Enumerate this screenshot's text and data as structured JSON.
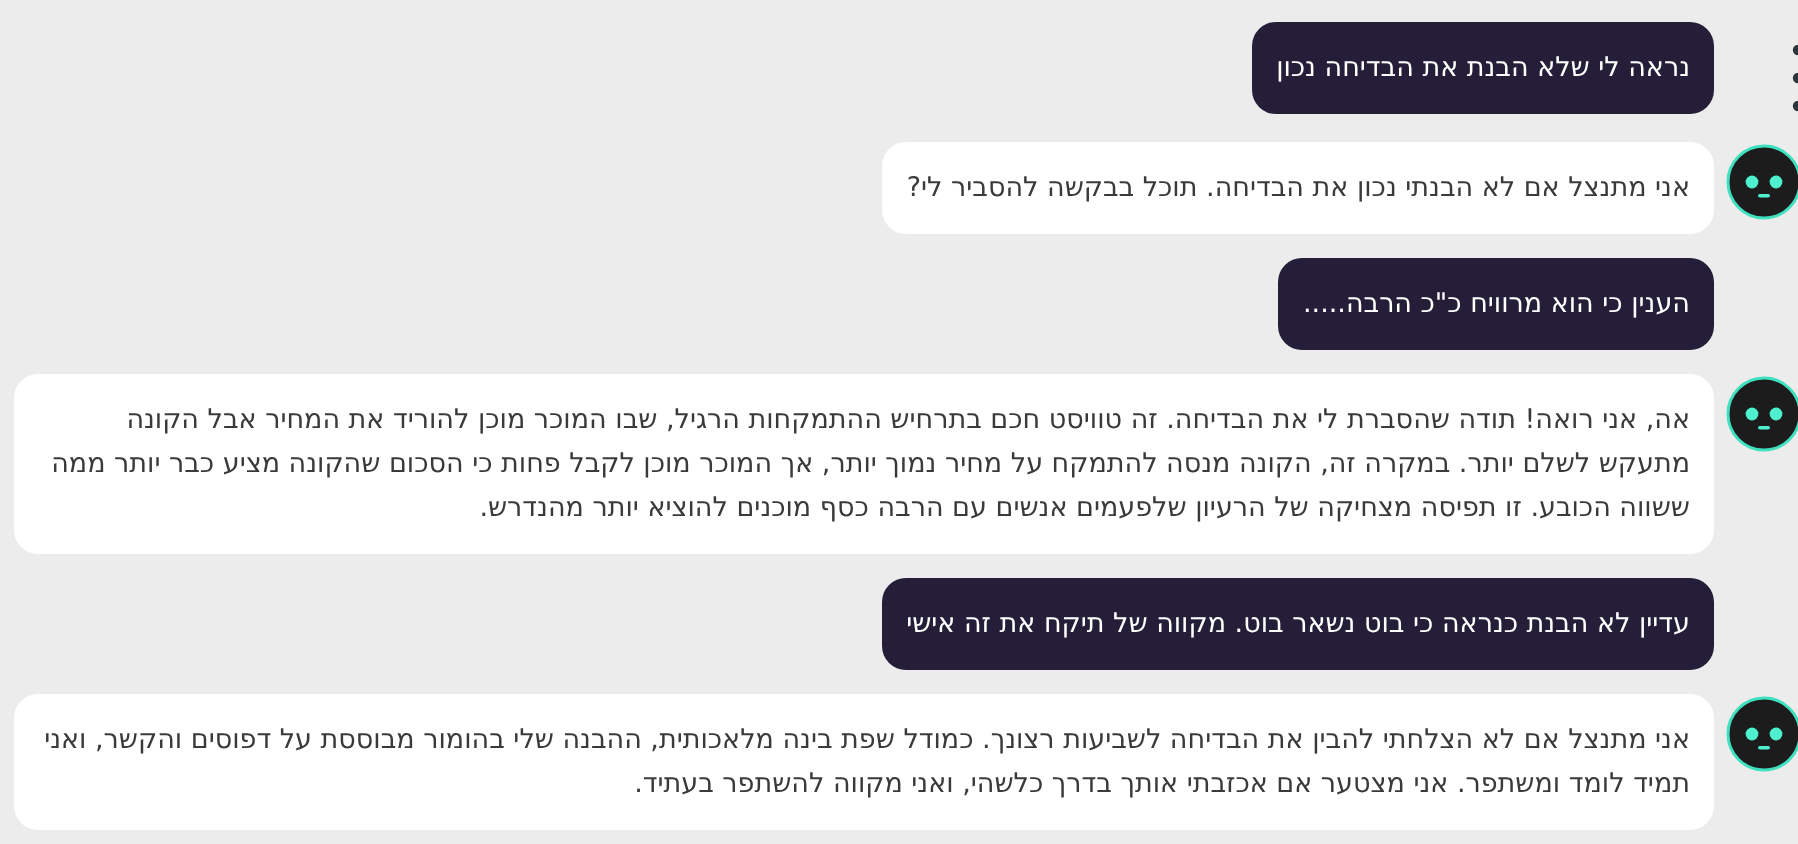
{
  "messages": [
    {
      "kind": "user",
      "text": "נראה לי שלא הבנת את הבדיחה נכון"
    },
    {
      "kind": "bot",
      "text": "אני מתנצל אם לא הבנתי נכון את הבדיחה. תוכל בבקשה להסביר לי?"
    },
    {
      "kind": "user",
      "text": "הענין כי הוא מרוויח כ\"כ הרבה....."
    },
    {
      "kind": "bot",
      "text": "אה, אני רואה! תודה שהסברת לי את הבדיחה. זה טוויסט חכם בתרחיש ההתמקחות הרגיל, שבו המוכר מוכן להוריד את המחיר אבל הקונה מתעקש לשלם יותר. במקרה זה, הקונה מנסה להתמקח על מחיר נמוך יותר, אך המוכר מוכן לקבל פחות כי הסכום שהקונה מציע כבר יותר ממה ששווה הכובע. זו תפיסה מצחיקה של הרעיון שלפעמים אנשים עם הרבה כסף מוכנים להוציא יותר מהנדרש."
    },
    {
      "kind": "user",
      "text": "עדיין לא הבנת כנראה כי בוט נשאר בוט. מקווה של תיקח את זה אישי"
    },
    {
      "kind": "bot",
      "text": "אני מתנצל אם לא הצלחתי להבין את הבדיחה לשביעות רצונך. כמודל שפת בינה מלאכותית, ההבנה שלי בהומור מבוססת על דפוסים והקשר, ואני תמיד לומד ומשתפר. אני מצטער אם אכזבתי אותך בדרך כלשהי, ואני מקווה להשתפר בעתיד."
    }
  ]
}
